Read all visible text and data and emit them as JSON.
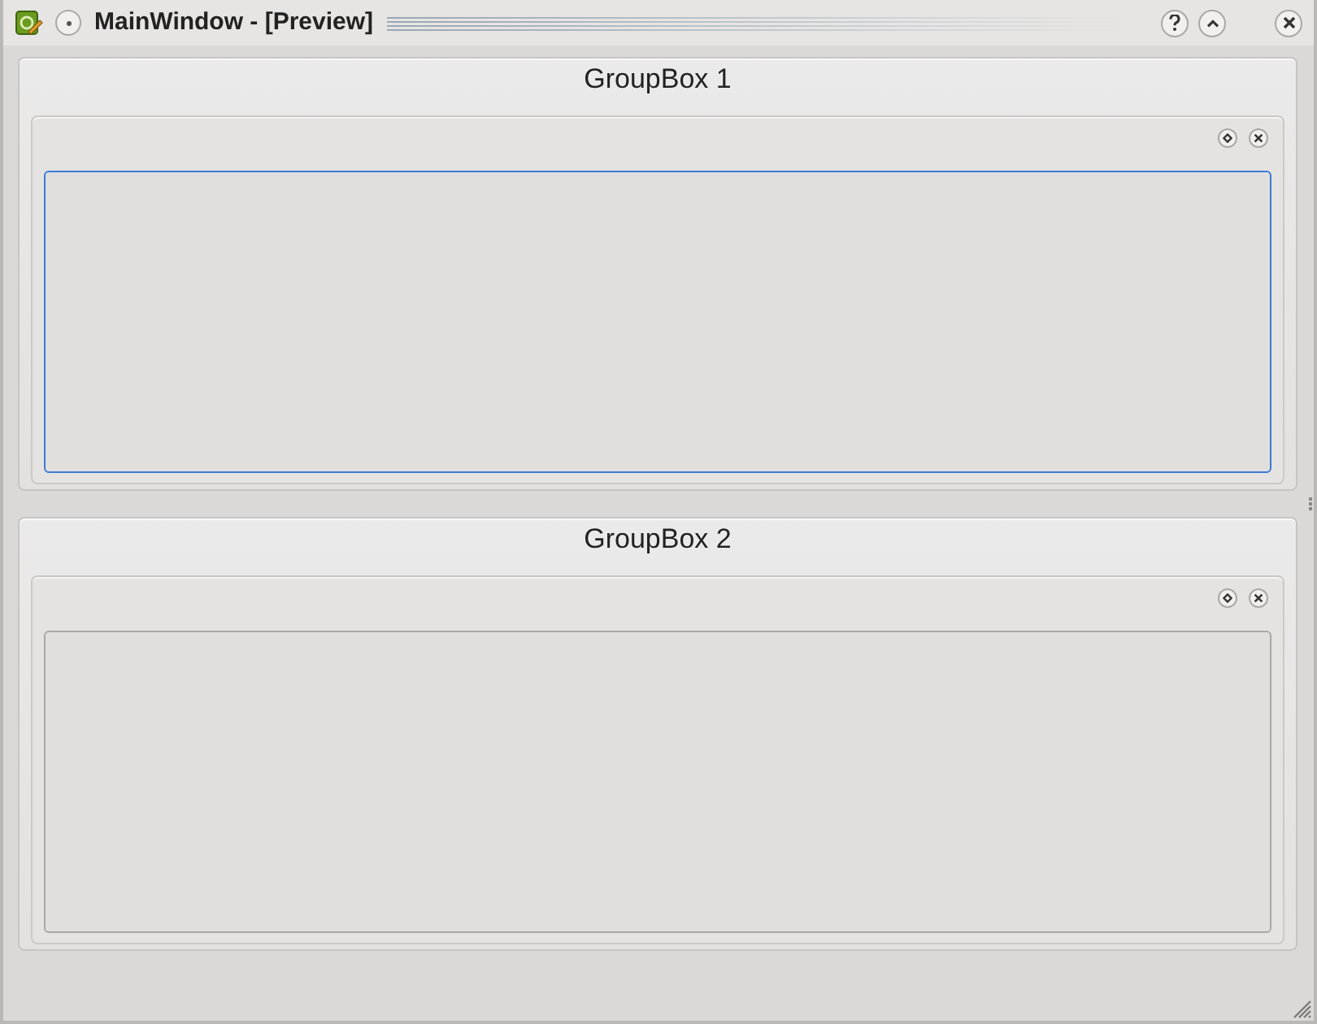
{
  "window": {
    "title": "MainWindow - [Preview]"
  },
  "group_boxes": [
    {
      "title": "GroupBox 1",
      "dock": {
        "focused": true
      }
    },
    {
      "title": "GroupBox 2",
      "dock": {
        "focused": false
      }
    }
  ]
}
